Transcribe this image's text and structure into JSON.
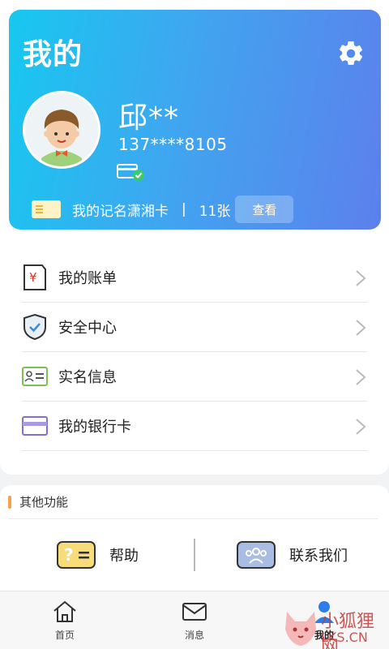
{
  "header": {
    "title": "我的",
    "settings_icon": "gear-icon"
  },
  "user": {
    "name": "邱**",
    "phone": "137****8105",
    "avatar_icon": "avatar-boy",
    "card_badge_icon": "verified-card-icon"
  },
  "card_bar": {
    "label": "我的记名潇湘卡",
    "separator": "|",
    "count": "11张",
    "view_button": "查看"
  },
  "menu": [
    {
      "label": "我的账单",
      "icon": "bill-icon"
    },
    {
      "label": "安全中心",
      "icon": "shield-icon"
    },
    {
      "label": "实名信息",
      "icon": "id-card-icon"
    },
    {
      "label": "我的银行卡",
      "icon": "bank-card-icon"
    }
  ],
  "other": {
    "title": "其他功能",
    "items": [
      {
        "label": "帮助",
        "icon": "help-icon"
      },
      {
        "label": "联系我们",
        "icon": "contact-icon"
      }
    ]
  },
  "tabs": [
    {
      "label": "首页",
      "icon": "home-icon"
    },
    {
      "label": "消息",
      "icon": "mail-icon"
    },
    {
      "label": "我的",
      "icon": "person-icon",
      "active": true
    }
  ],
  "watermark": {
    "text1": "小狐狸网",
    "text2": "LKS.CN"
  },
  "colors": {
    "card_gradient_start": "#17c8f0",
    "card_gradient_end": "#5d80ec",
    "accent_orange": "#f7a24b",
    "watermark_red": "#c43c3c"
  }
}
